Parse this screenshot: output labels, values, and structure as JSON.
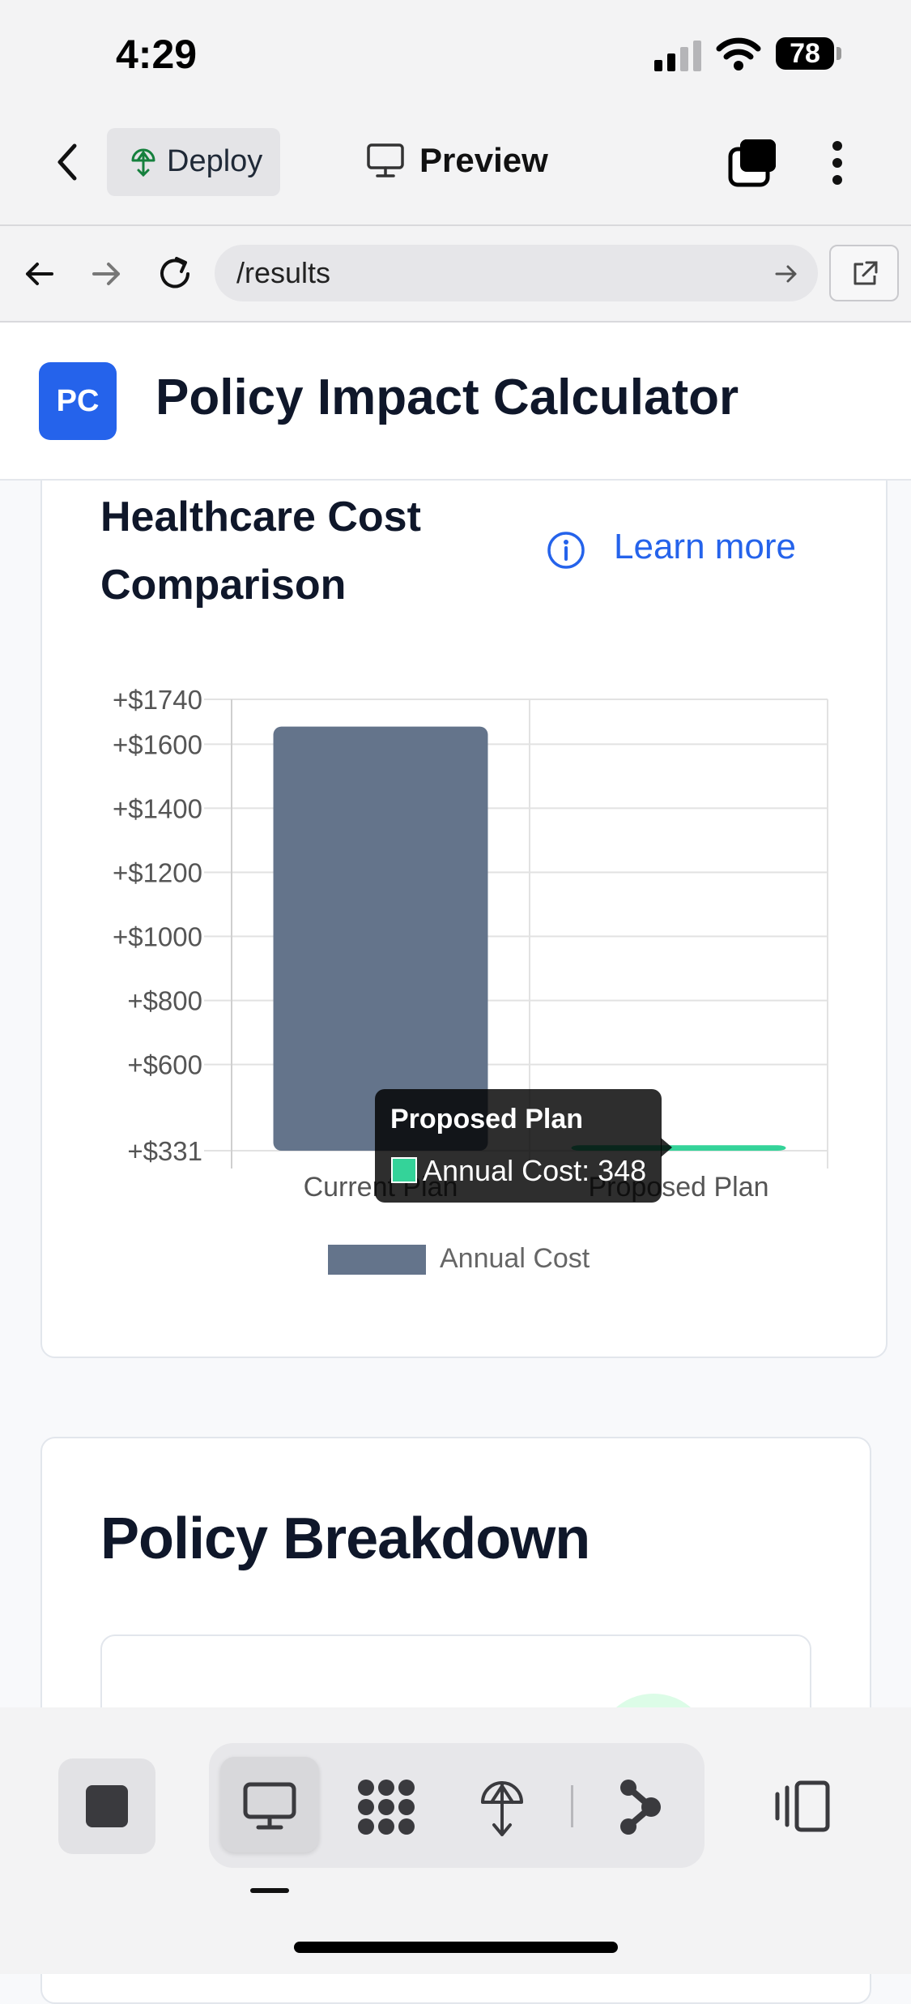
{
  "status_bar": {
    "time": "4:29",
    "battery": "78"
  },
  "toolbar": {
    "deploy_label": "Deploy",
    "preview_label": "Preview"
  },
  "url_bar": {
    "url": "/results"
  },
  "app": {
    "logo_text": "PC",
    "title": "Policy Impact Calculator"
  },
  "card": {
    "title": "Healthcare Cost Comparison",
    "learn_more": "Learn more"
  },
  "tooltip": {
    "title": "Proposed Plan",
    "body": "Annual Cost: 348"
  },
  "colors": {
    "current": "#64748b",
    "proposed": "#34d399",
    "accent": "#2563eb"
  },
  "chart_data": {
    "type": "bar",
    "categories": [
      "Current Plan",
      "Proposed Plan"
    ],
    "series": [
      {
        "name": "Annual Cost",
        "values": [
          1655,
          348
        ]
      }
    ],
    "ytick_labels": [
      "+$1740",
      "+$1600",
      "+$1400",
      "+$1200",
      "+$1000",
      "+$800",
      "+$600",
      "+$331"
    ],
    "ytick_values": [
      1740,
      1600,
      1400,
      1200,
      1000,
      800,
      600,
      331
    ],
    "ylim": [
      331,
      1740
    ],
    "grid": true,
    "legend": "bottom"
  },
  "breakdown": {
    "title": "Policy Breakdown"
  },
  "bottom_nav": {
    "items": [
      "stop-icon",
      "monitor-icon",
      "nodes-icon",
      "deploy-icon",
      "share-icon",
      "device-icon"
    ]
  }
}
